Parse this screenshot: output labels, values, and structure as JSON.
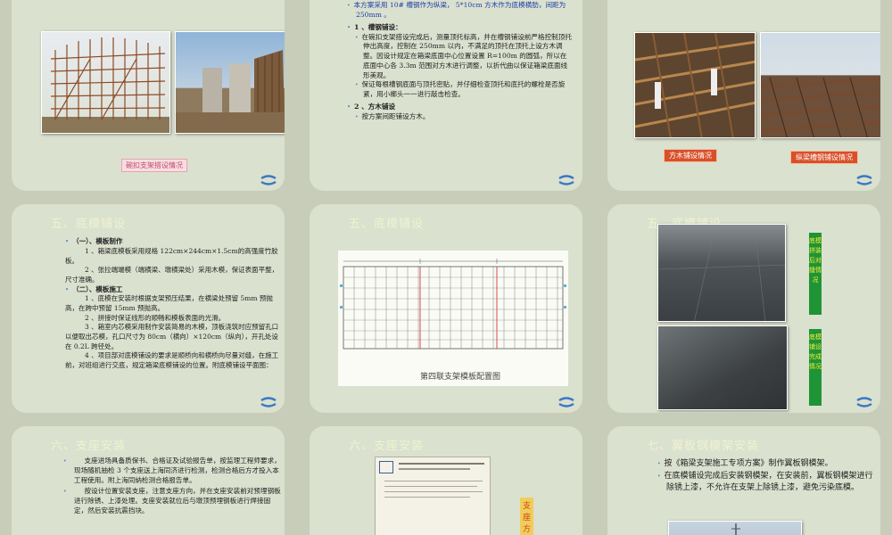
{
  "s1": {
    "caption": "碗扣支架搭设情况"
  },
  "s2": {
    "line1": "本方案采用 10# 槽钢作为纵梁， 5*10cm 方木作为底模横肋，间距为 250mm 。",
    "h1": "1 、槽钢铺设：",
    "p1": "在碗扣支架搭设完成后，测量顶托标高，并在槽钢铺设前严格控制顶托伸出高度，控制在 250mm 以内，不满足的顶托在顶托上设方木调整。因设计规定在箱梁底面中心位置设置 R=100m 的圆弧，所以在底面中心各 3.3m 范围对方木进行调整，以折代曲以保证箱梁底面线形美观。",
    "p2": "保证每根槽钢底面与顶托密贴，并仔细检查顶托和底托的螺栓是否旋紧，用小榔头一一进行敲击检查。",
    "h2": "2 、方木铺设",
    "p3": "按方案间距铺设方木。"
  },
  "s3": {
    "cap1": "方木铺设情况",
    "cap2": "纵梁槽钢铺设情况"
  },
  "s4": {
    "title": "五、底模铺设",
    "h1": "（一）、模板制作",
    "p1": "1 、箱梁底模板采用规格 122cm×244cm×1.5cm的高强度竹胶板。",
    "p2": "2 、张拉端端模（端横梁、墩横梁处）采用木模，保证表面平整，尺寸准确。",
    "h2": "（二）、模板施工",
    "p3": "1 、底模在安装时根据支架预压结果，在横梁处预留 5mm 预抛高，在跨中预留 15mm 预抛高。",
    "p4": "2 、拼接时保证线形的顺畅和模板表面的光滑。",
    "p5": "3 、箱室内芯模采用制作安装简易的木模，顶板浇筑时应预留孔口以便取出芯模，孔口尺寸为 80cm（横向）×120cm（纵向），开孔处设在 0.2L 跨径处。",
    "p6": "4 、项目部对底模铺设的要求是顺桥向和横桥向尽量对缝，在施工前，对班组进行交底，规定箱梁底模铺设的位置。附底模铺设平面图："
  },
  "s5": {
    "title": "五、底模铺设",
    "caption": "第四联支架模板配置图"
  },
  "s6": {
    "title": "五、底模铺设",
    "bar1": "底模拼装后对缝情况",
    "bar2": "底模铺设完成情况"
  },
  "s7": {
    "title": "六、支座安装",
    "p1": "支座进场具备质保书、合格证及试验报告单，按监理工程师要求，现场随机抽检 3 个支座送上海同济进行检测，检测合格后方才投入本工程使用。附上海同纳检测合格报告单。",
    "p2": "按设计位置安装支座，注意支座方向，并在支座安装前对预埋钢板进行除锈、上漆处理。支座安装就位后与墩顶预埋钢板进行焊接固定，然后安装抗震挡块。"
  },
  "s8": {
    "title": "六、支座安装",
    "bar": "支座方"
  },
  "s9": {
    "title": "七、翼板钢模架安装",
    "p1": "按《箱梁支架施工专项方案》制作翼板钢模架。",
    "p2": "在底模铺设完成后安装钢模架，在安装前，翼板钢模架进行除锈上漆，不允许在支架上除锈上漆，避免污染底模。"
  }
}
